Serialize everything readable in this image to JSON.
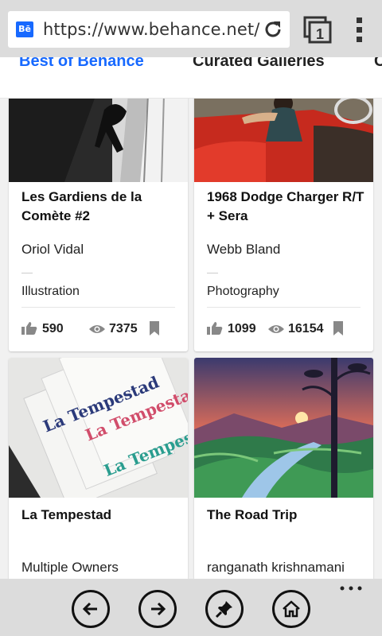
{
  "browser": {
    "favicon_text": "Bē",
    "url": "https://www.behance.net/",
    "tab_count": "1"
  },
  "categories": {
    "tabs": [
      {
        "label": "Best of Behance",
        "active": true
      },
      {
        "label": "Curated Galleries",
        "active": false
      },
      {
        "label": "C",
        "active": false
      }
    ]
  },
  "cards": [
    {
      "title": "Les Gardiens de la Comète #2",
      "owner": "Oriol Vidal",
      "field": "Illustration",
      "appreciations": "590",
      "views": "7375"
    },
    {
      "title": "1968 Dodge Charger R/T + Sera",
      "owner": "Webb Bland",
      "field": "Photography",
      "appreciations": "1099",
      "views": "16154"
    },
    {
      "title": "La Tempestad",
      "owner": "Multiple Owners",
      "thumb_text": [
        "La Tempestad",
        "La Tempestad",
        "La Tempestad"
      ]
    },
    {
      "title": "The Road Trip",
      "owner": "ranganath krishnamani"
    }
  ],
  "icons": {
    "like": "thumbs-up-icon",
    "views": "eye-icon",
    "save": "bookmark-icon",
    "reload": "reload-icon",
    "tabs": "tabs-icon",
    "menu": "kebab-menu-icon",
    "back": "back-arrow-icon",
    "forward": "forward-arrow-icon",
    "pin": "pin-icon",
    "home": "home-icon",
    "more": "ellipsis-icon"
  },
  "colors": {
    "accent": "#1769ff",
    "chrome": "#dcdcdc"
  }
}
